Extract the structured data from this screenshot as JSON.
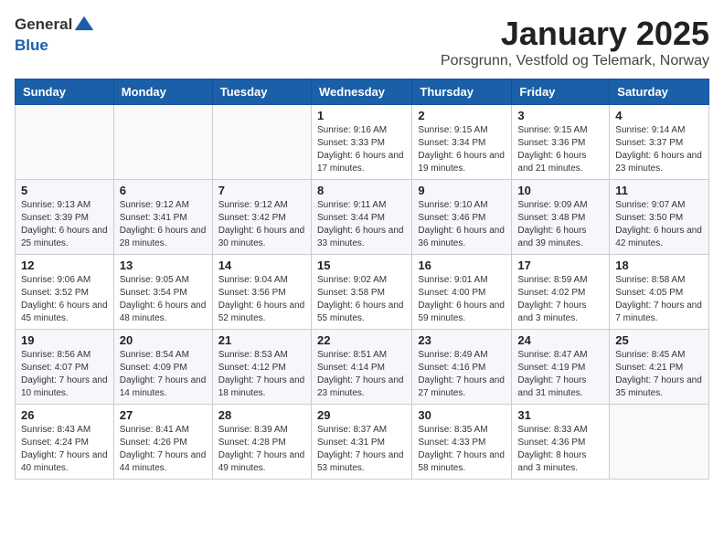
{
  "logo": {
    "general": "General",
    "blue": "Blue"
  },
  "header": {
    "title": "January 2025",
    "subtitle": "Porsgrunn, Vestfold og Telemark, Norway"
  },
  "columns": [
    "Sunday",
    "Monday",
    "Tuesday",
    "Wednesday",
    "Thursday",
    "Friday",
    "Saturday"
  ],
  "weeks": [
    [
      {
        "day": "",
        "info": ""
      },
      {
        "day": "",
        "info": ""
      },
      {
        "day": "",
        "info": ""
      },
      {
        "day": "1",
        "info": "Sunrise: 9:16 AM\nSunset: 3:33 PM\nDaylight: 6 hours and 17 minutes."
      },
      {
        "day": "2",
        "info": "Sunrise: 9:15 AM\nSunset: 3:34 PM\nDaylight: 6 hours and 19 minutes."
      },
      {
        "day": "3",
        "info": "Sunrise: 9:15 AM\nSunset: 3:36 PM\nDaylight: 6 hours and 21 minutes."
      },
      {
        "day": "4",
        "info": "Sunrise: 9:14 AM\nSunset: 3:37 PM\nDaylight: 6 hours and 23 minutes."
      }
    ],
    [
      {
        "day": "5",
        "info": "Sunrise: 9:13 AM\nSunset: 3:39 PM\nDaylight: 6 hours and 25 minutes."
      },
      {
        "day": "6",
        "info": "Sunrise: 9:12 AM\nSunset: 3:41 PM\nDaylight: 6 hours and 28 minutes."
      },
      {
        "day": "7",
        "info": "Sunrise: 9:12 AM\nSunset: 3:42 PM\nDaylight: 6 hours and 30 minutes."
      },
      {
        "day": "8",
        "info": "Sunrise: 9:11 AM\nSunset: 3:44 PM\nDaylight: 6 hours and 33 minutes."
      },
      {
        "day": "9",
        "info": "Sunrise: 9:10 AM\nSunset: 3:46 PM\nDaylight: 6 hours and 36 minutes."
      },
      {
        "day": "10",
        "info": "Sunrise: 9:09 AM\nSunset: 3:48 PM\nDaylight: 6 hours and 39 minutes."
      },
      {
        "day": "11",
        "info": "Sunrise: 9:07 AM\nSunset: 3:50 PM\nDaylight: 6 hours and 42 minutes."
      }
    ],
    [
      {
        "day": "12",
        "info": "Sunrise: 9:06 AM\nSunset: 3:52 PM\nDaylight: 6 hours and 45 minutes."
      },
      {
        "day": "13",
        "info": "Sunrise: 9:05 AM\nSunset: 3:54 PM\nDaylight: 6 hours and 48 minutes."
      },
      {
        "day": "14",
        "info": "Sunrise: 9:04 AM\nSunset: 3:56 PM\nDaylight: 6 hours and 52 minutes."
      },
      {
        "day": "15",
        "info": "Sunrise: 9:02 AM\nSunset: 3:58 PM\nDaylight: 6 hours and 55 minutes."
      },
      {
        "day": "16",
        "info": "Sunrise: 9:01 AM\nSunset: 4:00 PM\nDaylight: 6 hours and 59 minutes."
      },
      {
        "day": "17",
        "info": "Sunrise: 8:59 AM\nSunset: 4:02 PM\nDaylight: 7 hours and 3 minutes."
      },
      {
        "day": "18",
        "info": "Sunrise: 8:58 AM\nSunset: 4:05 PM\nDaylight: 7 hours and 7 minutes."
      }
    ],
    [
      {
        "day": "19",
        "info": "Sunrise: 8:56 AM\nSunset: 4:07 PM\nDaylight: 7 hours and 10 minutes."
      },
      {
        "day": "20",
        "info": "Sunrise: 8:54 AM\nSunset: 4:09 PM\nDaylight: 7 hours and 14 minutes."
      },
      {
        "day": "21",
        "info": "Sunrise: 8:53 AM\nSunset: 4:12 PM\nDaylight: 7 hours and 18 minutes."
      },
      {
        "day": "22",
        "info": "Sunrise: 8:51 AM\nSunset: 4:14 PM\nDaylight: 7 hours and 23 minutes."
      },
      {
        "day": "23",
        "info": "Sunrise: 8:49 AM\nSunset: 4:16 PM\nDaylight: 7 hours and 27 minutes."
      },
      {
        "day": "24",
        "info": "Sunrise: 8:47 AM\nSunset: 4:19 PM\nDaylight: 7 hours and 31 minutes."
      },
      {
        "day": "25",
        "info": "Sunrise: 8:45 AM\nSunset: 4:21 PM\nDaylight: 7 hours and 35 minutes."
      }
    ],
    [
      {
        "day": "26",
        "info": "Sunrise: 8:43 AM\nSunset: 4:24 PM\nDaylight: 7 hours and 40 minutes."
      },
      {
        "day": "27",
        "info": "Sunrise: 8:41 AM\nSunset: 4:26 PM\nDaylight: 7 hours and 44 minutes."
      },
      {
        "day": "28",
        "info": "Sunrise: 8:39 AM\nSunset: 4:28 PM\nDaylight: 7 hours and 49 minutes."
      },
      {
        "day": "29",
        "info": "Sunrise: 8:37 AM\nSunset: 4:31 PM\nDaylight: 7 hours and 53 minutes."
      },
      {
        "day": "30",
        "info": "Sunrise: 8:35 AM\nSunset: 4:33 PM\nDaylight: 7 hours and 58 minutes."
      },
      {
        "day": "31",
        "info": "Sunrise: 8:33 AM\nSunset: 4:36 PM\nDaylight: 8 hours and 3 minutes."
      },
      {
        "day": "",
        "info": ""
      }
    ]
  ]
}
